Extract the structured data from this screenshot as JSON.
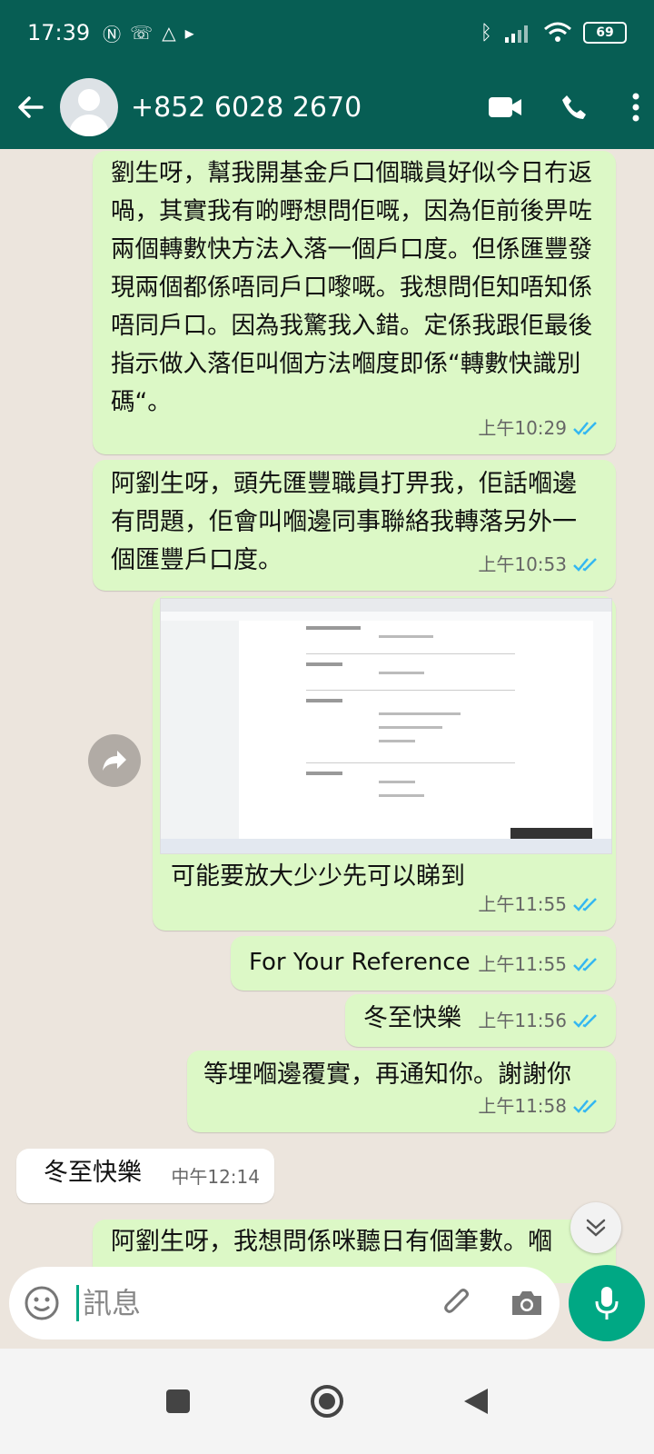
{
  "status_bar": {
    "time": "17:39",
    "battery": "69"
  },
  "header": {
    "contact": "+852 6028 2670"
  },
  "messages": [
    {
      "text": "劉生呀，幫我開基金戶口個職員好似今日冇返喎，其實我有啲嘢想問佢嘅，因為佢前後畀咗兩個轉數快方法入落一個戶口度。但係匯豐發現兩個都係唔同戶口嚟嘅。我想問佢知唔知係唔同戶口。因為我驚我入錯。定係我跟佢最後指示做入落佢叫個方法嗰度即係“轉數快識別碼“。",
      "time": "上午10:29"
    },
    {
      "text": "阿劉生呀，頭先匯豐職員打畀我，佢話嗰邊有問題，佢會叫嗰邊同事聯絡我轉落另外一個匯豐戶口度。",
      "time": "上午10:53"
    },
    {
      "caption": "可能要放大少少先可以睇到",
      "time": "上午11:55"
    },
    {
      "text": "For Your Reference",
      "time": "上午11:55"
    },
    {
      "text": "冬至快樂",
      "time": "上午11:56"
    },
    {
      "text": "等埋嗰邊覆實，再通知你。謝謝你",
      "time": "上午11:58"
    },
    {
      "text": "冬至快樂",
      "time": "中午12:14"
    },
    {
      "text": "阿劉生呀，我想問係咪聽日有個筆數。嗰"
    }
  ],
  "input": {
    "placeholder": "訊息"
  },
  "colors": {
    "header": "#075E54",
    "outgoing": "#DCF8C6",
    "incoming": "#FFFFFF",
    "accent": "#00A884",
    "tick": "#34B7F1"
  }
}
